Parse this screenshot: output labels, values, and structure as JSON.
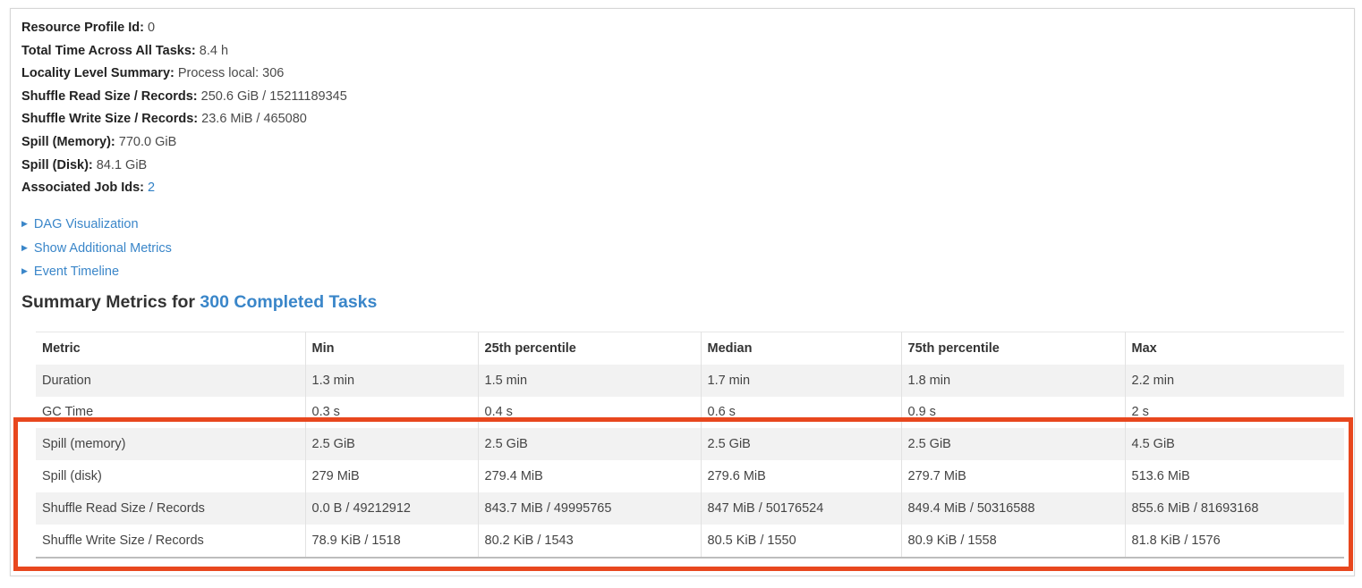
{
  "summary_info": {
    "items": [
      {
        "label": "Resource Profile Id:",
        "value": " 0"
      },
      {
        "label": "Total Time Across All Tasks:",
        "value": " 8.4 h"
      },
      {
        "label": "Locality Level Summary:",
        "value": " Process local: 306"
      },
      {
        "label": "Shuffle Read Size / Records:",
        "value": " 250.6 GiB / 15211189345"
      },
      {
        "label": "Shuffle Write Size / Records:",
        "value": " 23.6 MiB / 465080"
      },
      {
        "label": "Spill (Memory):",
        "value": " 770.0 GiB"
      },
      {
        "label": "Spill (Disk):",
        "value": " 84.1 GiB"
      }
    ],
    "associated_jobs_label": "Associated Job Ids:",
    "associated_jobs_link": "2"
  },
  "toggles": [
    {
      "icon": "triangle-right-icon",
      "label": "DAG Visualization"
    },
    {
      "icon": "triangle-right-icon",
      "label": "Show Additional Metrics"
    },
    {
      "icon": "triangle-right-icon",
      "label": "Event Timeline"
    }
  ],
  "summary_metrics": {
    "heading_prefix": "Summary Metrics for ",
    "heading_link": "300 Completed Tasks",
    "columns": [
      "Metric",
      "Min",
      "25th percentile",
      "Median",
      "75th percentile",
      "Max"
    ],
    "rows": [
      [
        "Duration",
        "1.3 min",
        "1.5 min",
        "1.7 min",
        "1.8 min",
        "2.2 min"
      ],
      [
        "GC Time",
        "0.3 s",
        "0.4 s",
        "0.6 s",
        "0.9 s",
        "2 s"
      ],
      [
        "Spill (memory)",
        "2.5 GiB",
        "2.5 GiB",
        "2.5 GiB",
        "2.5 GiB",
        "4.5 GiB"
      ],
      [
        "Spill (disk)",
        "279 MiB",
        "279.4 MiB",
        "279.6 MiB",
        "279.7 MiB",
        "513.6 MiB"
      ],
      [
        "Shuffle Read Size / Records",
        "0.0 B / 49212912",
        "843.7 MiB / 49995765",
        "847 MiB / 50176524",
        "849.4 MiB / 50316588",
        "855.6 MiB / 81693168"
      ],
      [
        "Shuffle Write Size / Records",
        "78.9 KiB / 1518",
        "80.2 KiB / 1543",
        "80.5 KiB / 1550",
        "80.9 KiB / 1558",
        "81.8 KiB / 1576"
      ]
    ]
  },
  "colors": {
    "link": "#3a86c9",
    "highlight_box": "#e8471e",
    "row_stripe": "#f2f2f2"
  }
}
